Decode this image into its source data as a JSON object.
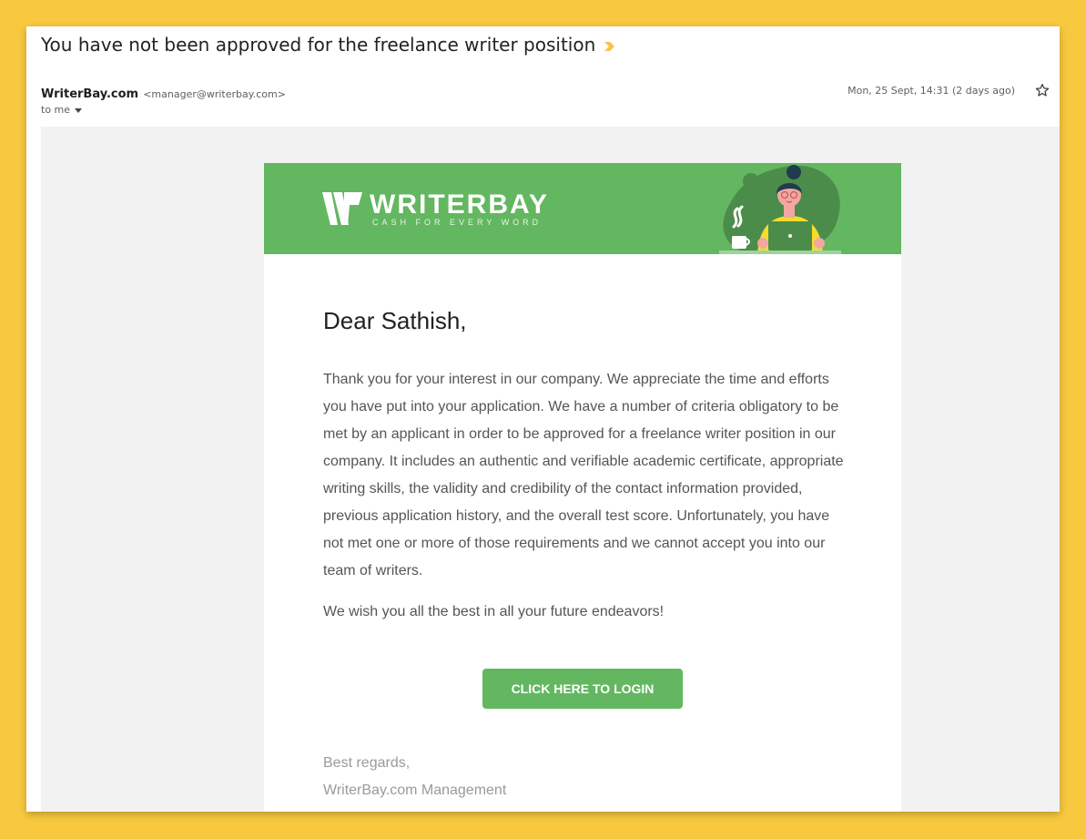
{
  "email": {
    "subject": "You have not been approved for the freelance writer position",
    "sender_name": "WriterBay.com",
    "sender_email": "<manager@writerbay.com>",
    "recipient": "to me",
    "date": "Mon, 25 Sept, 14:31 (2 days ago)"
  },
  "banner": {
    "brand": "WRITERBAY",
    "tagline": "CASH FOR EVERY WORD",
    "color": "#63b760"
  },
  "body": {
    "greeting": "Dear Sathish,",
    "paragraph1": "Thank you for your interest in our company. We appreciate the time and efforts you have put into your application. We have a number of criteria obligatory to be met by an applicant in order to be approved for a freelance writer position in our company. It includes an authentic and verifiable academic certificate, appropriate writing skills, the validity and credibility of the contact information provided, previous application history, and the overall test score. Unfortunately, you have not met one or more of those requirements and we cannot accept you into our team of writers.",
    "paragraph2": "We wish you all the best in all your future endeavors!",
    "button_label": "CLICK HERE TO LOGIN",
    "signoff": "Best regards,",
    "signature": "WriterBay.com Management"
  },
  "icons": {
    "importance": "importance-marker-icon",
    "star": "star-icon",
    "dropdown": "chevron-down-icon"
  },
  "colors": {
    "page_background": "#f8c93f",
    "accent_green": "#63b760",
    "importance_marker": "#f6c343"
  }
}
